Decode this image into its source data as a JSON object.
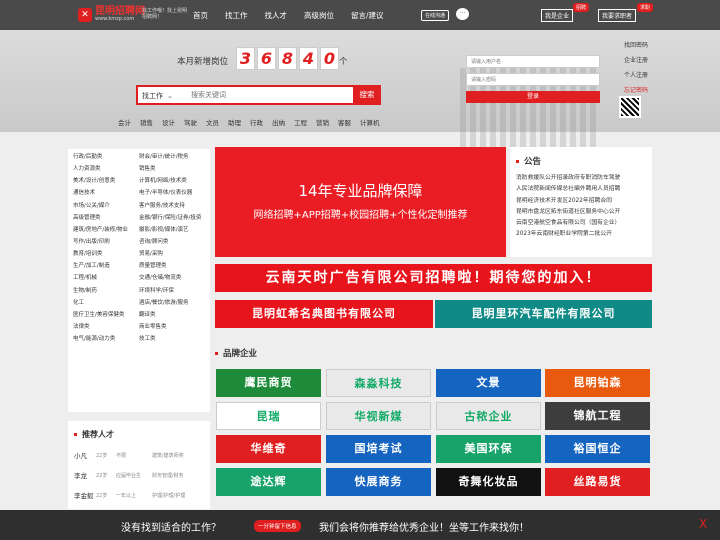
{
  "nav": {
    "logo": "昆明招聘网",
    "logo_sub": "www.kmzp.com",
    "slogan": "找工作哦！找上昆明招聘网！",
    "items": [
      "首页",
      "找工作",
      "找人才",
      "高级岗位",
      "留言/建议"
    ],
    "online": "在线沟通",
    "my_company": "我是企业",
    "my_company_badge": "招聘",
    "job_seeker": "我要求职者",
    "job_seeker_badge": "求职"
  },
  "hero": {
    "count_label": "本月新增岗位",
    "digits": [
      "3",
      "6",
      "8",
      "4",
      "0"
    ],
    "unit": "个",
    "search_type": "找工作",
    "search_placeholder": "搜索关键词",
    "search_button": "搜索",
    "hot_keywords": [
      "会计",
      "销售",
      "设计",
      "驾驶",
      "文员",
      "助理",
      "行政",
      "出纳",
      "工程",
      "营销",
      "客服",
      "计算机"
    ],
    "login_user_placeholder": "请输入用户名",
    "login_pass_placeholder": "请输入密码",
    "login_button": "登录",
    "side_links": [
      "找回密码",
      "企业注册",
      "个人注册",
      "忘记密码"
    ]
  },
  "categories": [
    "行政/后勤类",
    "财会/审计/统计/税务",
    "人力资源类",
    "销售类",
    "美术/设计/创意类",
    "计算机/网络/技术类",
    "通信技术",
    "电子/半导体/仪表仪器",
    "市场/公关/媒介",
    "客户服务/技术支持",
    "高级管理类",
    "金融/银行/保险/证券/投资",
    "建筑/房地产/装修/物业",
    "摄影/影视/媒体/演艺",
    "写作/出版/印刷",
    "咨询/顾问类",
    "教育/培训类",
    "贸易/采购",
    "生产/加工/制造",
    "质量管理类",
    "工程/机械",
    "交通/仓储/物流类",
    "生物/制药",
    "环境科学/环保",
    "化工",
    "酒店/餐饮/旅游/服务",
    "医疗卫生/美容保健类",
    "翻译类",
    "法律类",
    "商业零售类",
    "电气/能源/动力类",
    "技工类"
  ],
  "banner": {
    "title": "14年专业品牌保障",
    "subtitle": "网络招聘+APP招聘+校园招聘+个性化定制推荐"
  },
  "notice": {
    "title": "公告",
    "items": [
      "消防救援队公开招录政府专职消防车驾驶",
      "人民法院新闻传媒总社编外聘用人员招聘",
      "昆明经济技术开发区2022年招聘合同",
      "昆明市盘龙区拓东街道社区服务中心公开",
      "云南空港航空食品有限公司（国有企业）",
      "2023年云南财经职业学院第二批公开"
    ]
  },
  "ads": {
    "wide": "云南天时广告有限公司招聘啦！期待您的加入！",
    "left": "昆明虹希名典图书有限公司",
    "right": "昆明里环汽车配件有限公司"
  },
  "brands": {
    "title": "品牌企业",
    "items": [
      "鹰民商贸",
      "森淼科技",
      "文景",
      "昆明铂森",
      "昆瑞",
      "华视新媒",
      "古秾企业",
      "锦航工程",
      "华维奇",
      "国培考试",
      "美国环保",
      "裕国恒企",
      "途达辉",
      "快展商务",
      "奇舞化妆品",
      "丝路易货"
    ],
    "colors": [
      "#1e8b3a",
      "#e9e9e9",
      "#1565c0",
      "#e85a0e",
      "#ffffff",
      "#e9e9e9",
      "#e9e9e9",
      "#3d3d3d",
      "#e02020",
      "#1565c0",
      "#18a36a",
      "#1565c0",
      "#18a36a",
      "#1565c0",
      "#111111",
      "#e02020"
    ]
  },
  "talent": {
    "title": "推荐人才",
    "rows": [
      {
        "name": "小凡",
        "age": "22岁",
        "edu": "不限",
        "job": "建筑/建筑师类"
      },
      {
        "name": "李龙",
        "age": "22岁",
        "edu": "应届毕业生",
        "job": "财务管理/财务"
      },
      {
        "name": "李金毅",
        "age": "22岁",
        "edu": "一年以上",
        "job": "护理/护理/护理"
      }
    ]
  },
  "bottom": {
    "question": "没有找到适合的工作？",
    "button": "一分钟留下信息",
    "tagline": "我们会将你推荐给优秀企业！坐等工作来找你！",
    "close": "X"
  }
}
